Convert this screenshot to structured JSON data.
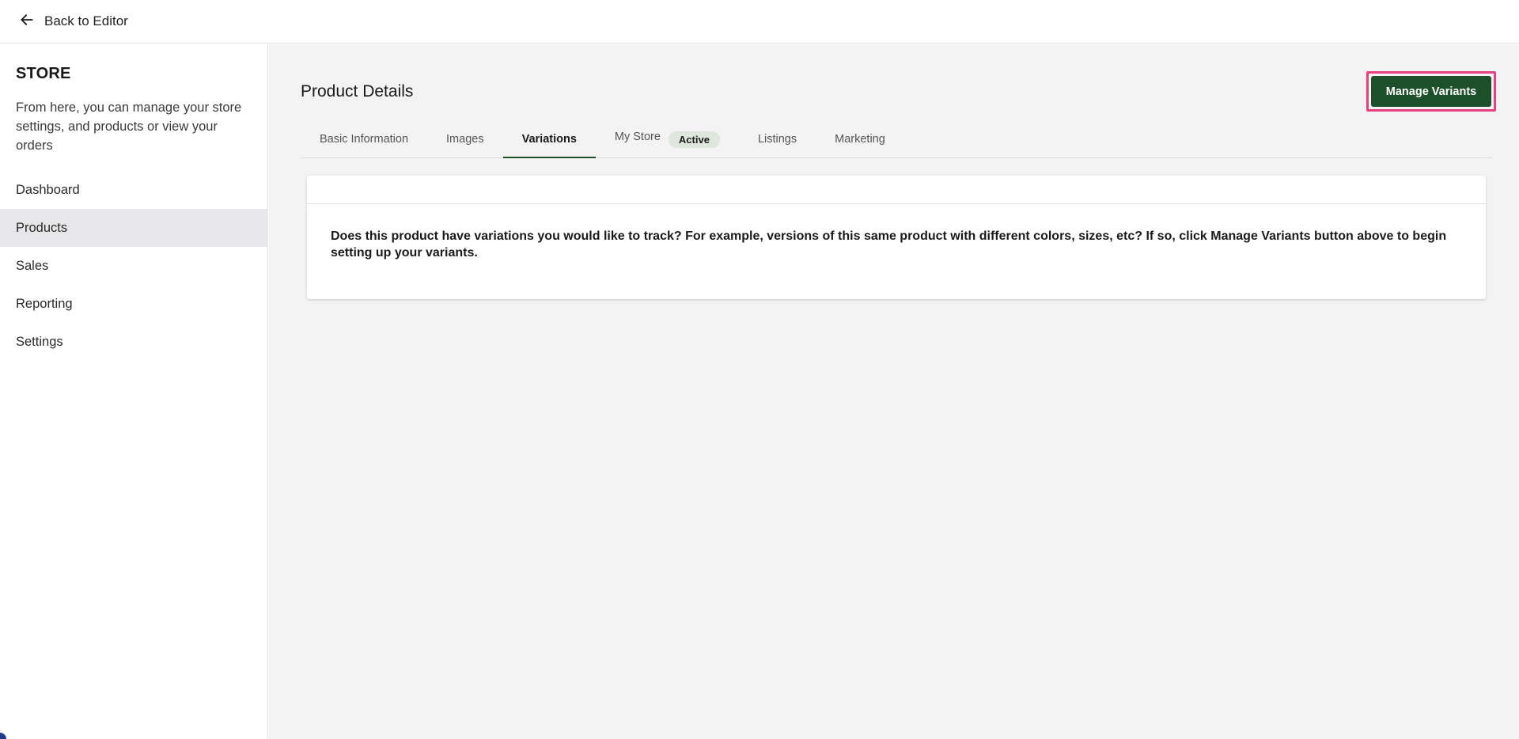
{
  "topbar": {
    "back_label": "Back to Editor",
    "back_icon": "arrow-left-icon"
  },
  "sidebar": {
    "title": "STORE",
    "description": "From here, you can manage your store settings, and products or view your orders",
    "items": [
      {
        "label": "Dashboard"
      },
      {
        "label": "Products",
        "active": true
      },
      {
        "label": "Sales"
      },
      {
        "label": "Reporting"
      },
      {
        "label": "Settings"
      }
    ]
  },
  "main": {
    "title": "Product Details",
    "manage_button": "Manage Variants",
    "tabs": [
      {
        "label": "Basic Information"
      },
      {
        "label": "Images"
      },
      {
        "label": "Variations",
        "active": true
      },
      {
        "label": "My Store",
        "badge": "Active"
      },
      {
        "label": "Listings"
      },
      {
        "label": "Marketing"
      }
    ],
    "card_text": "Does this product have variations you would like to track? For example, versions of this same product with different colors, sizes, etc? If so, click Manage Variants button above to begin setting up your variants."
  },
  "colors": {
    "accent": "#1d4f2a",
    "highlight": "#e8407f",
    "sidebar_active": "#e7e7e9",
    "main_bg": "#f3f3f3"
  }
}
